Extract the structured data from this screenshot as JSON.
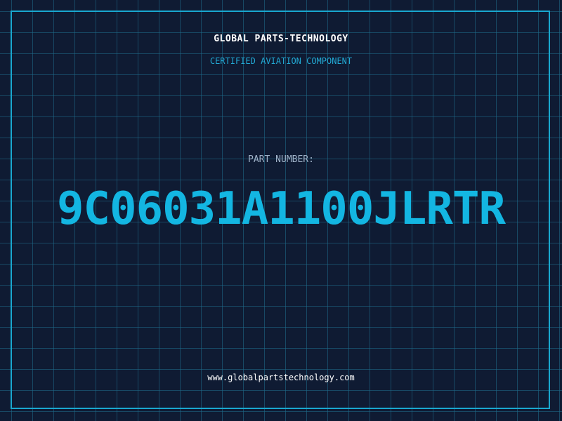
{
  "header": {
    "company": "GLOBAL PARTS-TECHNOLOGY",
    "subtitle": "CERTIFIED AVIATION COMPONENT"
  },
  "part": {
    "label": "PART NUMBER:",
    "number": "9C06031A1100JLRTR"
  },
  "footer": {
    "url": "www.globalpartstechnology.com"
  },
  "colors": {
    "background": "#0f1b33",
    "accent": "#13b6e2",
    "grid": "#1e6e8c"
  }
}
